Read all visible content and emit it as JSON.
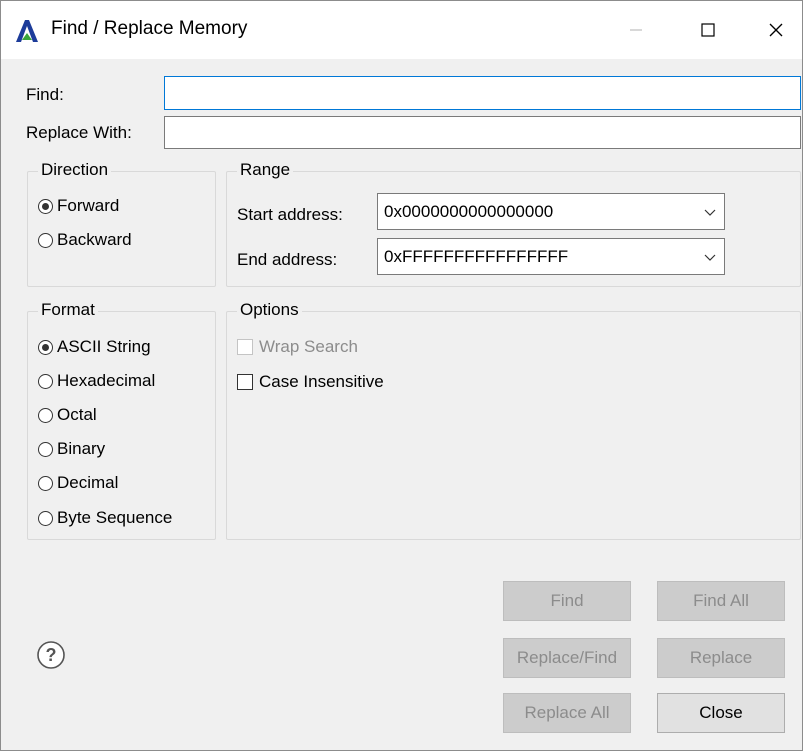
{
  "window": {
    "title": "Find / Replace Memory"
  },
  "titlebar": {
    "minimize_icon": "minimize-icon",
    "maximize_icon": "maximize-icon",
    "close_icon": "close-icon"
  },
  "find": {
    "label": "Find:",
    "value": ""
  },
  "replace": {
    "label": "Replace With:",
    "value": ""
  },
  "direction": {
    "legend": "Direction",
    "options": [
      {
        "label": "Forward",
        "selected": true
      },
      {
        "label": "Backward",
        "selected": false
      }
    ]
  },
  "range": {
    "legend": "Range",
    "start_label": "Start address:",
    "start_value": "0x0000000000000000",
    "end_label": "End address:",
    "end_value": "0xFFFFFFFFFFFFFFFF"
  },
  "format": {
    "legend": "Format",
    "options": [
      {
        "label": "ASCII String",
        "selected": true
      },
      {
        "label": "Hexadecimal",
        "selected": false
      },
      {
        "label": "Octal",
        "selected": false
      },
      {
        "label": "Binary",
        "selected": false
      },
      {
        "label": "Decimal",
        "selected": false
      },
      {
        "label": "Byte Sequence",
        "selected": false
      }
    ]
  },
  "options": {
    "legend": "Options",
    "wrap_search": {
      "label": "Wrap Search",
      "checked": false,
      "enabled": false
    },
    "case_insensitive": {
      "label": "Case Insensitive",
      "checked": false,
      "enabled": true
    }
  },
  "buttons": {
    "find": "Find",
    "find_all": "Find All",
    "replace_find": "Replace/Find",
    "replace": "Replace",
    "replace_all": "Replace All",
    "close": "Close"
  },
  "help_icon": "help-icon"
}
